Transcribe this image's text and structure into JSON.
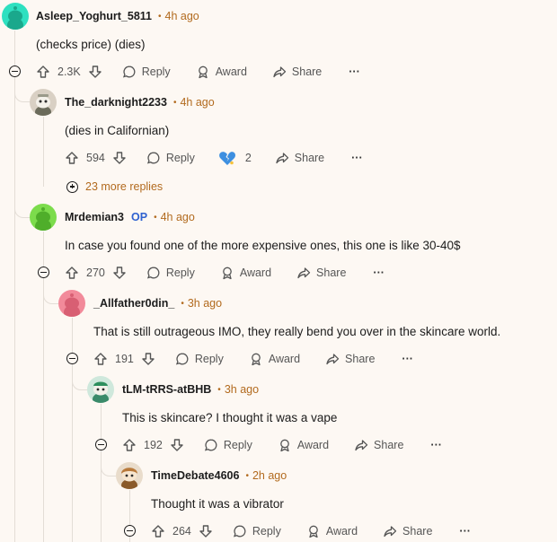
{
  "comments": [
    {
      "username": "Asleep_Yoghurt_5811",
      "time": "4h ago",
      "text": "(checks price) (dies)",
      "score": "2.3K",
      "actions": {
        "reply": "Reply",
        "award": "Award",
        "share": "Share",
        "more": "···"
      },
      "avatar_color": "#2ee0c0"
    },
    {
      "username": "The_darknight2233",
      "time": "4h ago",
      "text": "(dies in Californian)",
      "score": "594",
      "award_count": "2",
      "actions": {
        "reply": "Reply",
        "share": "Share",
        "more": "···"
      },
      "more_replies": "23 more replies",
      "avatar_color": "#d9d0c4"
    },
    {
      "username": "Mrdemian3",
      "op_badge": "OP",
      "time": "4h ago",
      "text": "In case you found one of the more expensive ones, this one is like 30-40$",
      "score": "270",
      "actions": {
        "reply": "Reply",
        "award": "Award",
        "share": "Share",
        "more": "···"
      },
      "avatar_color": "#7cdc4c"
    },
    {
      "username": "_Allfather0din_",
      "time": "3h ago",
      "text": "That is still outrageous IMO, they really bend you over in the skincare world.",
      "score": "191",
      "actions": {
        "reply": "Reply",
        "award": "Award",
        "share": "Share",
        "more": "···"
      },
      "avatar_color": "#f28a9a"
    },
    {
      "username": "tLM-tRRS-atBHB",
      "time": "3h ago",
      "text": "This is skincare? I thought it was a vape",
      "score": "192",
      "actions": {
        "reply": "Reply",
        "award": "Award",
        "share": "Share",
        "more": "···"
      },
      "avatar_color": "#cfe8dc"
    },
    {
      "username": "TimeDebate4606",
      "time": "2h ago",
      "text": "Thought it was a vibrator",
      "score": "264",
      "actions": {
        "reply": "Reply",
        "award": "Award",
        "share": "Share",
        "more": "···"
      },
      "avatar_color": "#e9dccb"
    }
  ],
  "colors": {
    "background": "#fdf8f3",
    "timestamp": "#b26a1e",
    "op": "#2f62d0",
    "thread_line": "#e3ddd6"
  }
}
